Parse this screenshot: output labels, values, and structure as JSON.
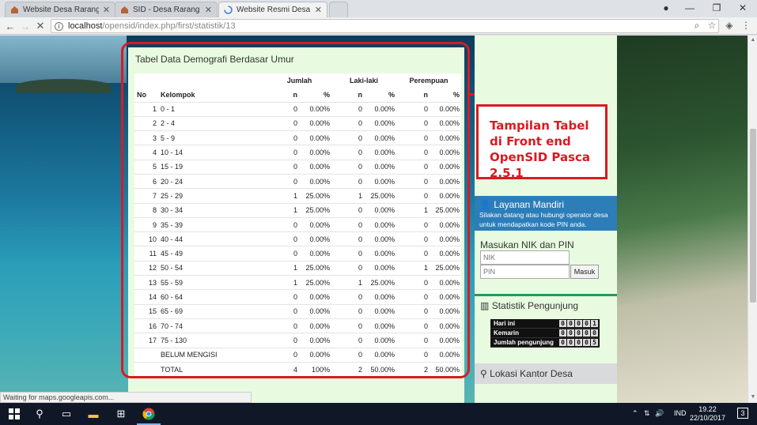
{
  "browser": {
    "tabs": [
      {
        "title": "Website Desa Rarang Sel",
        "active": false
      },
      {
        "title": "SID - Desa Rarang Selata",
        "active": false
      },
      {
        "title": "Website Resmi Desa Rara",
        "active": true
      }
    ],
    "url_host": "localhost",
    "url_path": "/opensid/index.php/first/statistik/13",
    "status_text": "Waiting for maps.googleapis.com..."
  },
  "panel": {
    "title": "Tabel Data Demografi Berdasar Umur",
    "headers": {
      "no": "No",
      "kelompok": "Kelompok",
      "jumlah": "Jumlah",
      "laki": "Laki-laki",
      "perempuan": "Perempuan",
      "n": "n",
      "pct": "%"
    },
    "rows": [
      {
        "no": "1",
        "kelompok": "0 - 1",
        "jn": "0",
        "jp": "0.00%",
        "ln": "0",
        "lp": "0.00%",
        "pn": "0",
        "pp": "0.00%"
      },
      {
        "no": "2",
        "kelompok": "2 - 4",
        "jn": "0",
        "jp": "0.00%",
        "ln": "0",
        "lp": "0.00%",
        "pn": "0",
        "pp": "0.00%"
      },
      {
        "no": "3",
        "kelompok": "5 - 9",
        "jn": "0",
        "jp": "0.00%",
        "ln": "0",
        "lp": "0.00%",
        "pn": "0",
        "pp": "0.00%"
      },
      {
        "no": "4",
        "kelompok": "10 - 14",
        "jn": "0",
        "jp": "0.00%",
        "ln": "0",
        "lp": "0.00%",
        "pn": "0",
        "pp": "0.00%"
      },
      {
        "no": "5",
        "kelompok": "15 - 19",
        "jn": "0",
        "jp": "0.00%",
        "ln": "0",
        "lp": "0.00%",
        "pn": "0",
        "pp": "0.00%"
      },
      {
        "no": "6",
        "kelompok": "20 - 24",
        "jn": "0",
        "jp": "0.00%",
        "ln": "0",
        "lp": "0.00%",
        "pn": "0",
        "pp": "0.00%"
      },
      {
        "no": "7",
        "kelompok": "25 - 29",
        "jn": "1",
        "jp": "25.00%",
        "ln": "1",
        "lp": "25.00%",
        "pn": "0",
        "pp": "0.00%"
      },
      {
        "no": "8",
        "kelompok": "30 - 34",
        "jn": "1",
        "jp": "25.00%",
        "ln": "0",
        "lp": "0.00%",
        "pn": "1",
        "pp": "25.00%"
      },
      {
        "no": "9",
        "kelompok": "35 - 39",
        "jn": "0",
        "jp": "0.00%",
        "ln": "0",
        "lp": "0.00%",
        "pn": "0",
        "pp": "0.00%"
      },
      {
        "no": "10",
        "kelompok": "40 - 44",
        "jn": "0",
        "jp": "0.00%",
        "ln": "0",
        "lp": "0.00%",
        "pn": "0",
        "pp": "0.00%"
      },
      {
        "no": "11",
        "kelompok": "45 - 49",
        "jn": "0",
        "jp": "0.00%",
        "ln": "0",
        "lp": "0.00%",
        "pn": "0",
        "pp": "0.00%"
      },
      {
        "no": "12",
        "kelompok": "50 - 54",
        "jn": "1",
        "jp": "25.00%",
        "ln": "0",
        "lp": "0.00%",
        "pn": "1",
        "pp": "25.00%"
      },
      {
        "no": "13",
        "kelompok": "55 - 59",
        "jn": "1",
        "jp": "25.00%",
        "ln": "1",
        "lp": "25.00%",
        "pn": "0",
        "pp": "0.00%"
      },
      {
        "no": "14",
        "kelompok": "60 - 64",
        "jn": "0",
        "jp": "0.00%",
        "ln": "0",
        "lp": "0.00%",
        "pn": "0",
        "pp": "0.00%"
      },
      {
        "no": "15",
        "kelompok": "65 - 69",
        "jn": "0",
        "jp": "0.00%",
        "ln": "0",
        "lp": "0.00%",
        "pn": "0",
        "pp": "0.00%"
      },
      {
        "no": "16",
        "kelompok": "70 - 74",
        "jn": "0",
        "jp": "0.00%",
        "ln": "0",
        "lp": "0.00%",
        "pn": "0",
        "pp": "0.00%"
      },
      {
        "no": "17",
        "kelompok": "75 - 130",
        "jn": "0",
        "jp": "0.00%",
        "ln": "0",
        "lp": "0.00%",
        "pn": "0",
        "pp": "0.00%"
      },
      {
        "no": "",
        "kelompok": "BELUM MENGISI",
        "jn": "0",
        "jp": "0.00%",
        "ln": "0",
        "lp": "0.00%",
        "pn": "0",
        "pp": "0.00%"
      },
      {
        "no": "",
        "kelompok": "TOTAL",
        "jn": "4",
        "jp": "100%",
        "ln": "2",
        "lp": "50.00%",
        "pn": "2",
        "pp": "50.00%"
      }
    ]
  },
  "annotation": {
    "text": "Tampilan Tabel di Front end OpenSID Pasca 2.5.1",
    "color": "#d81b22"
  },
  "sidebar": {
    "layanan_title": "Layanan Mandiri",
    "layanan_desc": "Silakan datang atau hubungi operator desa untuk mendapatkan kode PIN anda.",
    "login_title": "Masukan NIK dan PIN",
    "nik_placeholder": "NIK",
    "pin_placeholder": "PIN",
    "masuk_label": "Masuk",
    "stat_title": "Statistik Pengunjung",
    "counter": [
      {
        "label": "Hari ini",
        "digits": [
          "0",
          "0",
          "0",
          "0",
          "1"
        ]
      },
      {
        "label": "Kemarin",
        "digits": [
          "0",
          "0",
          "0",
          "0",
          "0"
        ]
      },
      {
        "label": "Jumlah pengunjung",
        "digits": [
          "0",
          "0",
          "0",
          "0",
          "5"
        ]
      }
    ],
    "lokasi_title": "Lokasi Kantor Desa",
    "accent_blue": "#2c7db8",
    "accent_green": "#1e9b5a"
  },
  "taskbar": {
    "language": "IND",
    "time": "19.22",
    "date": "22/10/2017",
    "notifications": "3"
  }
}
